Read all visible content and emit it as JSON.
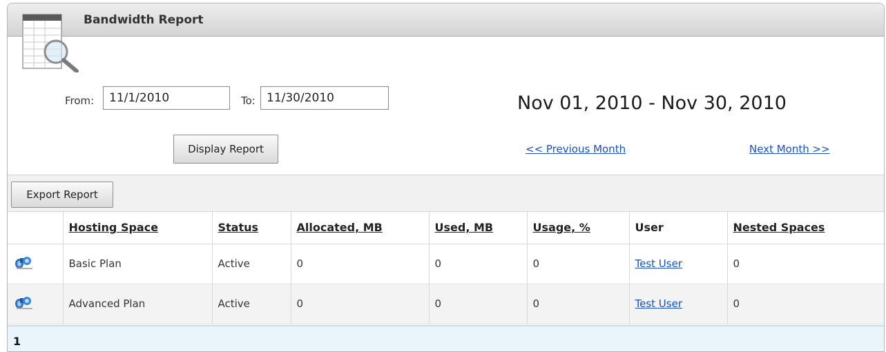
{
  "header": {
    "title": "Bandwidth Report"
  },
  "filter": {
    "from_label": "From:",
    "from_value": "11/1/2010",
    "to_label": "To:",
    "to_value": "11/30/2010",
    "display_button": "Display Report"
  },
  "period": {
    "range_text": "Nov 01, 2010 - Nov 30, 2010",
    "prev_link": "<< Previous Month",
    "next_link": "Next Month >>"
  },
  "toolbar": {
    "export_button": "Export Report"
  },
  "table": {
    "columns": [
      "Hosting Space",
      "Status",
      "Allocated, MB",
      "Used, MB",
      "Usage, %",
      "User",
      "Nested Spaces"
    ],
    "rows": [
      {
        "space": "Basic Plan",
        "status": "Active",
        "allocated": "0",
        "used": "0",
        "usage": "0",
        "user": "Test User",
        "nested": "0"
      },
      {
        "space": "Advanced Plan",
        "status": "Active",
        "allocated": "0",
        "used": "0",
        "usage": "0",
        "user": "Test User",
        "nested": "0"
      }
    ]
  },
  "pager": {
    "current_page": "1"
  },
  "icons": {
    "report": "report-magnifier-icon",
    "space": "space-binoculars-icon"
  }
}
